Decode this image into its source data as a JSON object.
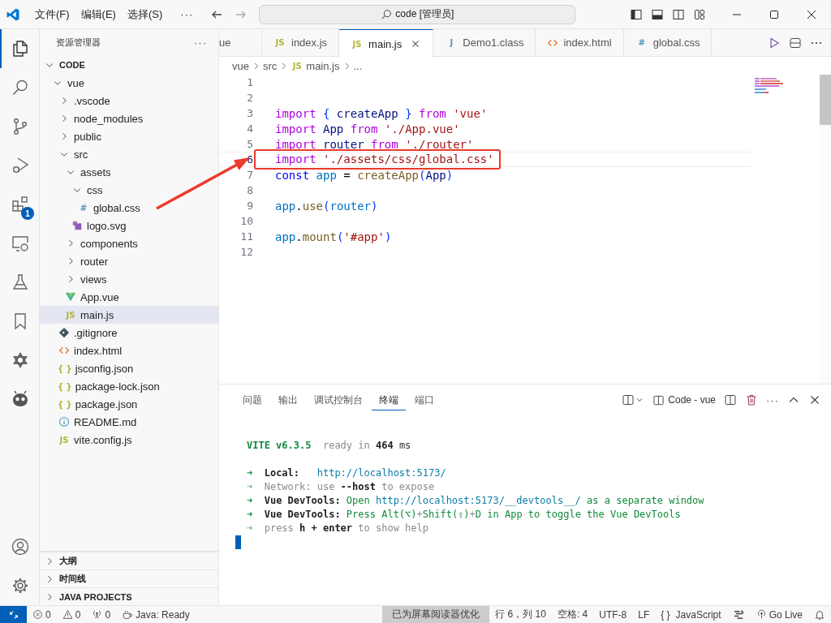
{
  "titlebar": {
    "menus": [
      {
        "label": "文件(F)"
      },
      {
        "label": "编辑(E)"
      },
      {
        "label": "选择(S)"
      }
    ],
    "more": "···",
    "search": "code [管理员]"
  },
  "activity_bar": {
    "items": [
      {
        "kind": "explorer",
        "selected": true
      },
      {
        "kind": "search",
        "selected": false
      },
      {
        "kind": "source-control",
        "selected": false
      },
      {
        "kind": "run-debug",
        "selected": false
      },
      {
        "kind": "extensions",
        "selected": false,
        "badge": "1"
      },
      {
        "kind": "remote",
        "selected": false
      },
      {
        "kind": "testing",
        "selected": false
      },
      {
        "kind": "bookmarks",
        "selected": false
      },
      {
        "kind": "star",
        "selected": false
      },
      {
        "kind": "robot",
        "selected": false
      }
    ],
    "bottom": [
      {
        "kind": "account"
      },
      {
        "kind": "settings"
      }
    ]
  },
  "sidebar": {
    "title": "资源管理器",
    "more": "···",
    "root": {
      "title": "CODE",
      "expanded": true
    },
    "tree": [
      {
        "label": "vue",
        "kind": "folder",
        "expanded": true,
        "selected": false,
        "children": [
          {
            "label": ".vscode",
            "kind": "folder",
            "expanded": false,
            "selected": false
          },
          {
            "label": "node_modules",
            "kind": "folder",
            "expanded": false,
            "selected": false
          },
          {
            "label": "public",
            "kind": "folder",
            "expanded": false,
            "selected": false
          },
          {
            "label": "src",
            "kind": "folder",
            "expanded": true,
            "selected": false,
            "children": [
              {
                "label": "assets",
                "kind": "folder",
                "expanded": true,
                "selected": false,
                "children": [
                  {
                    "label": "css",
                    "kind": "folder",
                    "expanded": true,
                    "selected": false,
                    "children": [
                      {
                        "label": "global.css",
                        "kind": "css",
                        "icon_text": "#",
                        "selected": false
                      }
                    ]
                  },
                  {
                    "label": "logo.svg",
                    "kind": "svg",
                    "selected": false
                  }
                ]
              },
              {
                "label": "components",
                "kind": "folder",
                "expanded": false,
                "selected": false
              },
              {
                "label": "router",
                "kind": "folder",
                "expanded": false,
                "selected": false
              },
              {
                "label": "views",
                "kind": "folder",
                "expanded": false,
                "selected": false
              },
              {
                "label": "App.vue",
                "kind": "vue",
                "selected": false
              },
              {
                "label": "main.js",
                "kind": "js",
                "icon_text": "JS",
                "selected": true
              }
            ]
          },
          {
            "label": ".gitignore",
            "kind": "git",
            "selected": false
          },
          {
            "label": "index.html",
            "kind": "html",
            "selected": false
          },
          {
            "label": "jsconfig.json",
            "kind": "json",
            "icon_text": "{ }",
            "selected": false
          },
          {
            "label": "package-lock.json",
            "kind": "json",
            "icon_text": "{ }",
            "selected": false
          },
          {
            "label": "package.json",
            "kind": "json",
            "icon_text": "{ }",
            "selected": false
          },
          {
            "label": "README.md",
            "kind": "info",
            "selected": false
          },
          {
            "label": "vite.config.js",
            "kind": "js",
            "icon_text": "JS",
            "selected": false
          }
        ]
      }
    ],
    "sections": [
      {
        "title": "大纲",
        "expanded": false
      },
      {
        "title": "时间线",
        "expanded": false
      },
      {
        "title": "JAVA PROJECTS",
        "expanded": false
      }
    ]
  },
  "tabs": [
    {
      "label": "ue",
      "kind": "none",
      "selected": false
    },
    {
      "label": "index.js",
      "kind": "js",
      "icon_text": "JS",
      "selected": false
    },
    {
      "label": "main.js",
      "kind": "js",
      "icon_text": "JS",
      "selected": true
    },
    {
      "label": "Demo1.class",
      "kind": "java",
      "icon_text": "J",
      "selected": false
    },
    {
      "label": "index.html",
      "kind": "html",
      "selected": false
    },
    {
      "label": "global.css",
      "kind": "css",
      "icon_text": "#",
      "selected": false
    }
  ],
  "breadcrumb": [
    {
      "label": "vue",
      "kind": "none"
    },
    {
      "label": "src",
      "kind": "none"
    },
    {
      "label": "main.js",
      "kind": "js",
      "icon_text": "JS"
    },
    {
      "label": "...",
      "kind": "none"
    }
  ],
  "code": [
    {
      "number": "1"
    },
    {
      "number": "2"
    },
    {
      "number": "3",
      "tokens": [
        {
          "text": "import",
          "kind": "kw"
        },
        {
          "text": " {",
          "kind": "brace"
        },
        {
          "text": " createApp ",
          "kind": "var"
        },
        {
          "text": "}",
          "kind": "brace"
        },
        {
          "text": " from",
          "kind": "kw"
        },
        {
          "text": " 'vue'",
          "kind": "str"
        }
      ]
    },
    {
      "number": "4",
      "tokens": [
        {
          "text": "import",
          "kind": "kw"
        },
        {
          "text": " App ",
          "kind": "var"
        },
        {
          "text": "from",
          "kind": "kw"
        },
        {
          "text": " './App.vue'",
          "kind": "str"
        }
      ]
    },
    {
      "number": "5",
      "tokens": [
        {
          "text": "import",
          "kind": "kw"
        },
        {
          "text": " router ",
          "kind": "var"
        },
        {
          "text": "from",
          "kind": "kw"
        },
        {
          "text": " './router'",
          "kind": "str"
        }
      ]
    },
    {
      "number": "6",
      "current": true,
      "annotated": true,
      "tokens": [
        {
          "text": "import",
          "kind": "kw"
        },
        {
          "text": " './assets/css/global.css'",
          "kind": "str"
        }
      ]
    },
    {
      "number": "7",
      "tokens": [
        {
          "text": "const",
          "kind": "storage"
        },
        {
          "text": " app",
          "kind": "var2"
        },
        {
          "text": " =",
          "kind": "plain"
        },
        {
          "text": " createApp",
          "kind": "fn"
        },
        {
          "text": "(",
          "kind": "brace"
        },
        {
          "text": "App",
          "kind": "var"
        },
        {
          "text": ")",
          "kind": "brace"
        }
      ]
    },
    {
      "number": "8"
    },
    {
      "number": "9",
      "tokens": [
        {
          "text": "app",
          "kind": "var2"
        },
        {
          "text": ".",
          "kind": "plain"
        },
        {
          "text": "use",
          "kind": "fn"
        },
        {
          "text": "(",
          "kind": "brace"
        },
        {
          "text": "router",
          "kind": "var2"
        },
        {
          "text": ")",
          "kind": "brace"
        }
      ]
    },
    {
      "number": "10"
    },
    {
      "number": "11",
      "tokens": [
        {
          "text": "app",
          "kind": "var2"
        },
        {
          "text": ".",
          "kind": "plain"
        },
        {
          "text": "mount",
          "kind": "fn"
        },
        {
          "text": "(",
          "kind": "brace"
        },
        {
          "text": "'#app'",
          "kind": "str"
        },
        {
          "text": ")",
          "kind": "brace"
        }
      ]
    },
    {
      "number": "12"
    }
  ],
  "panel": {
    "tabs": [
      {
        "label": "问题",
        "selected": false
      },
      {
        "label": "输出",
        "selected": false
      },
      {
        "label": "调试控制台",
        "selected": false
      },
      {
        "label": "终端",
        "selected": true
      },
      {
        "label": "端口",
        "selected": false
      }
    ],
    "terminal_name": "Code - vue",
    "more": "···",
    "terminal": [
      {
        "kind": "text",
        "tokens": [
          {
            "text": "VITE v6.3.5",
            "kind": "green-bold"
          },
          {
            "text": "  ready in ",
            "kind": "dim"
          },
          {
            "text": "464",
            "kind": "bold"
          },
          {
            "text": " ms",
            "kind": "plain"
          }
        ]
      },
      {
        "kind": "blank"
      },
      {
        "kind": "text",
        "tokens": [
          {
            "text": "➜",
            "kind": "green-bold"
          },
          {
            "text": "  Local:",
            "kind": "bold"
          },
          {
            "text": "   http://localhost:5173/",
            "kind": "cyan"
          }
        ]
      },
      {
        "kind": "text",
        "tokens": [
          {
            "text": "➜",
            "kind": "dim-green"
          },
          {
            "text": "  Network: use ",
            "kind": "dim"
          },
          {
            "text": "--host",
            "kind": "bold"
          },
          {
            "text": " to expose",
            "kind": "dim"
          }
        ]
      },
      {
        "kind": "text",
        "tokens": [
          {
            "text": "➜",
            "kind": "green-bold"
          },
          {
            "text": "  Vue DevTools: ",
            "kind": "bold"
          },
          {
            "text": "Open ",
            "kind": "green"
          },
          {
            "text": "http://localhost:5173/__devtools__/",
            "kind": "cyan"
          },
          {
            "text": " as a separate window",
            "kind": "green"
          }
        ]
      },
      {
        "kind": "text",
        "tokens": [
          {
            "text": "➜",
            "kind": "green-bold"
          },
          {
            "text": "  Vue DevTools: ",
            "kind": "bold"
          },
          {
            "text": "Press ",
            "kind": "green"
          },
          {
            "text": "Alt(⌥)",
            "kind": "green"
          },
          {
            "text": "+",
            "kind": "dim"
          },
          {
            "text": "Shift(⇧)",
            "kind": "green"
          },
          {
            "text": "+",
            "kind": "dim"
          },
          {
            "text": "D in App to toggle the Vue DevTools",
            "kind": "green"
          }
        ]
      },
      {
        "kind": "text",
        "tokens": [
          {
            "text": "➜",
            "kind": "dim-green"
          },
          {
            "text": "  press ",
            "kind": "dim"
          },
          {
            "text": "h + enter",
            "kind": "bold"
          },
          {
            "text": " to show help",
            "kind": "dim"
          }
        ]
      }
    ]
  },
  "status_bar": {
    "left": [
      {
        "kind": "remote"
      },
      {
        "kind": "errors",
        "text": "0"
      },
      {
        "kind": "warnings",
        "text": "0"
      },
      {
        "kind": "ports",
        "text": "0"
      },
      {
        "kind": "java",
        "text": "Java: Ready"
      }
    ],
    "right": [
      {
        "kind": "screen-reader",
        "text": "已为屏幕阅读器优化"
      },
      {
        "kind": "plain",
        "text": "行 6，列 10"
      },
      {
        "kind": "plain",
        "text": "空格: 4"
      },
      {
        "kind": "plain",
        "text": "UTF-8"
      },
      {
        "kind": "plain",
        "text": "LF"
      },
      {
        "kind": "language",
        "icon_text": "{ }",
        "text": "JavaScript"
      },
      {
        "kind": "prettier"
      },
      {
        "kind": "golive",
        "text": "Go Live"
      },
      {
        "kind": "bell"
      }
    ]
  }
}
